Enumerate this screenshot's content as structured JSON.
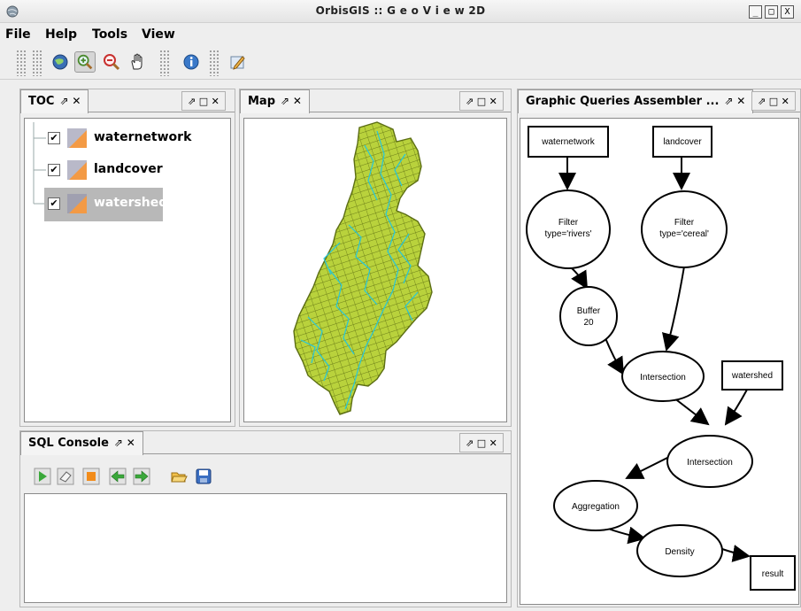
{
  "window": {
    "title": "OrbisGIS :: G e o V i e w  2D",
    "controls": [
      "_",
      "□",
      "X"
    ]
  },
  "menu": {
    "items": [
      "File",
      "Help",
      "Tools",
      "View"
    ]
  },
  "toolbar": {
    "buttons": [
      "globe-icon",
      "zoom-in-icon",
      "zoom-out-icon",
      "pan-hand-icon",
      "info-icon",
      "edit-pencil-icon"
    ]
  },
  "toc": {
    "tab_label": "TOC",
    "tab_controls": "⇗ ✕",
    "panel_controls": "⇗ □ ✕",
    "layers": [
      {
        "name": "waternetwork",
        "checked": "✔",
        "selected": false
      },
      {
        "name": "landcover",
        "checked": "✔",
        "selected": false
      },
      {
        "name": "watershed",
        "checked": "✔",
        "selected": true
      }
    ]
  },
  "map": {
    "tab_label": "Map",
    "tab_controls": "⇗ ✕",
    "panel_controls": "⇗ □ ✕"
  },
  "sql": {
    "tab_label": "SQL Console",
    "tab_controls": "⇗ ✕",
    "panel_controls": "⇗ □ ✕",
    "buttons": [
      "run-icon",
      "clear-icon",
      "stop-icon",
      "previous-icon",
      "next-icon",
      "open-icon",
      "save-icon"
    ]
  },
  "gqa": {
    "tab_label": "Graphic Queries Assembler ...",
    "tab_controls": "⇗ ✕",
    "panel_controls": "⇗ □ ✕",
    "nodes": {
      "waternetwork": "waternetwork",
      "landcover": "landcover",
      "filter1_line1": "Filter",
      "filter1_line2": "type='rivers'",
      "filter2_line1": "Filter",
      "filter2_line2": "type='cereal'",
      "buffer_line1": "Buffer",
      "buffer_line2": "20",
      "intersection1": "Intersection",
      "watershed": "watershed",
      "intersection2": "Intersection",
      "aggregation": "Aggregation",
      "density": "Density",
      "result": "result"
    }
  },
  "colors": {
    "map_fill": "#b9d23c",
    "map_stroke": "#5c6e14",
    "map_water": "#26c6da",
    "selection": "#b8b8b8"
  }
}
